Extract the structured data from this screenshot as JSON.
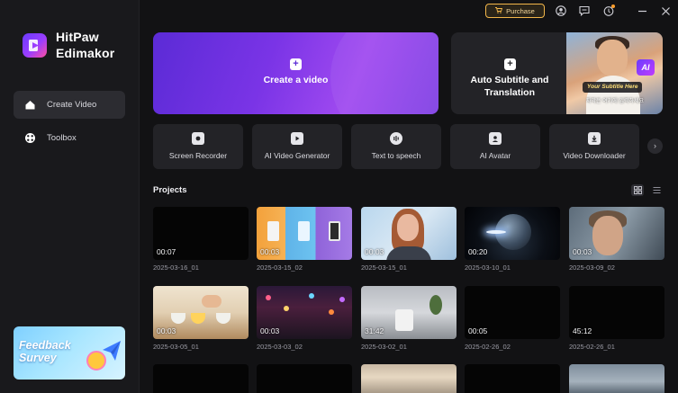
{
  "app": {
    "name_line1": "HitPaw",
    "name_line2": "Edimakor"
  },
  "sidebar": {
    "items": [
      {
        "label": "Create Video",
        "icon": "home-icon",
        "active": true
      },
      {
        "label": "Toolbox",
        "icon": "toolbox-icon",
        "active": false
      }
    ],
    "feedback": {
      "line1": "Feedback",
      "line2": "Survey"
    }
  },
  "topbar": {
    "purchase_label": "Purchase",
    "icons": [
      "user-icon",
      "message-icon",
      "notification-icon",
      "minimize-icon",
      "close-icon"
    ]
  },
  "hero": {
    "create_label": "Create a video",
    "subtitle_label_line1": "Auto Subtitle and",
    "subtitle_label_line2": "Translation",
    "subtitle_preview": "Your Subtitle Here",
    "subtitle_preview_kr": "자막은 여기에 입력하세요",
    "ai_badge": "AI"
  },
  "tools": [
    {
      "label": "Screen Recorder",
      "icon": "screen-recorder-icon"
    },
    {
      "label": "AI Video Generator",
      "icon": "video-generator-icon"
    },
    {
      "label": "Text to speech",
      "icon": "text-to-speech-icon"
    },
    {
      "label": "AI Avatar",
      "icon": "avatar-icon"
    },
    {
      "label": "Video Downloader",
      "icon": "download-icon"
    }
  ],
  "projects": {
    "title": "Projects",
    "items": [
      {
        "name": "2025-03-16_01",
        "duration": "00:07",
        "art": "black"
      },
      {
        "name": "2025-03-15_02",
        "duration": "00:03",
        "art": "tablets"
      },
      {
        "name": "2025-03-15_01",
        "duration": "00:03",
        "art": "girl"
      },
      {
        "name": "2025-03-10_01",
        "duration": "00:20",
        "art": "planet"
      },
      {
        "name": "2025-03-09_02",
        "duration": "00:03",
        "art": "man"
      },
      {
        "name": "2025-03-05_01",
        "duration": "00:03",
        "art": "food"
      },
      {
        "name": "2025-03-03_02",
        "duration": "00:03",
        "art": "city"
      },
      {
        "name": "2025-03-02_01",
        "duration": "31:42",
        "art": "room"
      },
      {
        "name": "2025-02-26_02",
        "duration": "00:05",
        "art": "black"
      },
      {
        "name": "2025-02-26_01",
        "duration": "45:12",
        "art": "black"
      }
    ]
  },
  "colors": {
    "accent": "#7a34e6",
    "purchase_border": "#f2b64a",
    "background": "#121214"
  }
}
